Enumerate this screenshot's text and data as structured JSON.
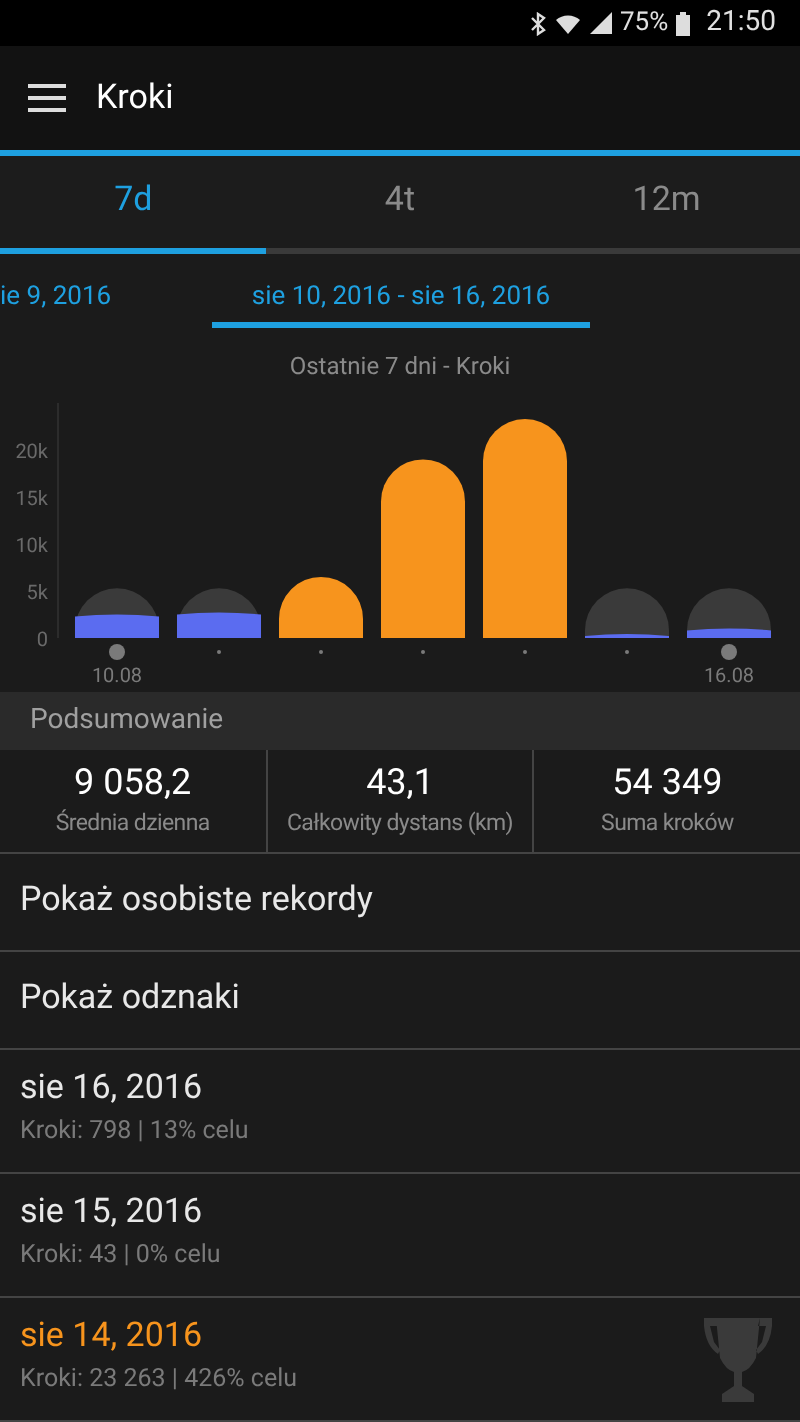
{
  "status_bar": {
    "battery": "75%",
    "time": "21:50"
  },
  "app_bar": {
    "title": "Kroki"
  },
  "tabs": [
    {
      "label": "7d",
      "selected": true
    },
    {
      "label": "4t",
      "selected": false
    },
    {
      "label": "12m",
      "selected": false
    }
  ],
  "date_ranges": [
    {
      "label": "ie 9, 2016",
      "selected": false
    },
    {
      "label": "sie 10, 2016 - sie 16, 2016",
      "selected": true
    }
  ],
  "chart": {
    "chart_data": {
      "type": "bar",
      "title": "Ostatnie 7 dni - Kroki",
      "categories": [
        "10.08",
        null,
        null,
        null,
        null,
        null,
        "16.08"
      ],
      "ylim": [
        0,
        25000
      ],
      "yticks": [
        {
          "value": 0,
          "label": "0"
        },
        {
          "value": 5000,
          "label": "5k"
        },
        {
          "value": 10000,
          "label": "10k"
        },
        {
          "value": 15000,
          "label": "15k"
        },
        {
          "value": 20000,
          "label": "20k"
        }
      ],
      "series": [
        {
          "color": "#5b6cf0",
          "values": [
            2300,
            2500,
            null,
            null,
            null,
            0,
            800
          ]
        },
        {
          "color": "#f7941d",
          "values": [
            null,
            null,
            6500,
            19000,
            23300,
            null,
            null
          ]
        }
      ]
    }
  },
  "summary": {
    "header": "Podsumowanie",
    "stats": [
      {
        "value": "9 058,2",
        "label": "Średnia dzienna"
      },
      {
        "value": "43,1",
        "label": "Całkowity dystans (km)"
      },
      {
        "value": "54 349",
        "label": "Suma kroków"
      }
    ]
  },
  "links": [
    "Pokaż osobiste rekordy",
    "Pokaż odznaki"
  ],
  "days": [
    {
      "date": "sie 16, 2016",
      "detail": "Kroki: 798 | 13% celu",
      "goal_met": false
    },
    {
      "date": "sie 15, 2016",
      "detail": "Kroki: 43 | 0% celu",
      "goal_met": false
    },
    {
      "date": "sie 14, 2016",
      "detail": "Kroki: 23 263 | 426% celu",
      "goal_met": true
    }
  ]
}
